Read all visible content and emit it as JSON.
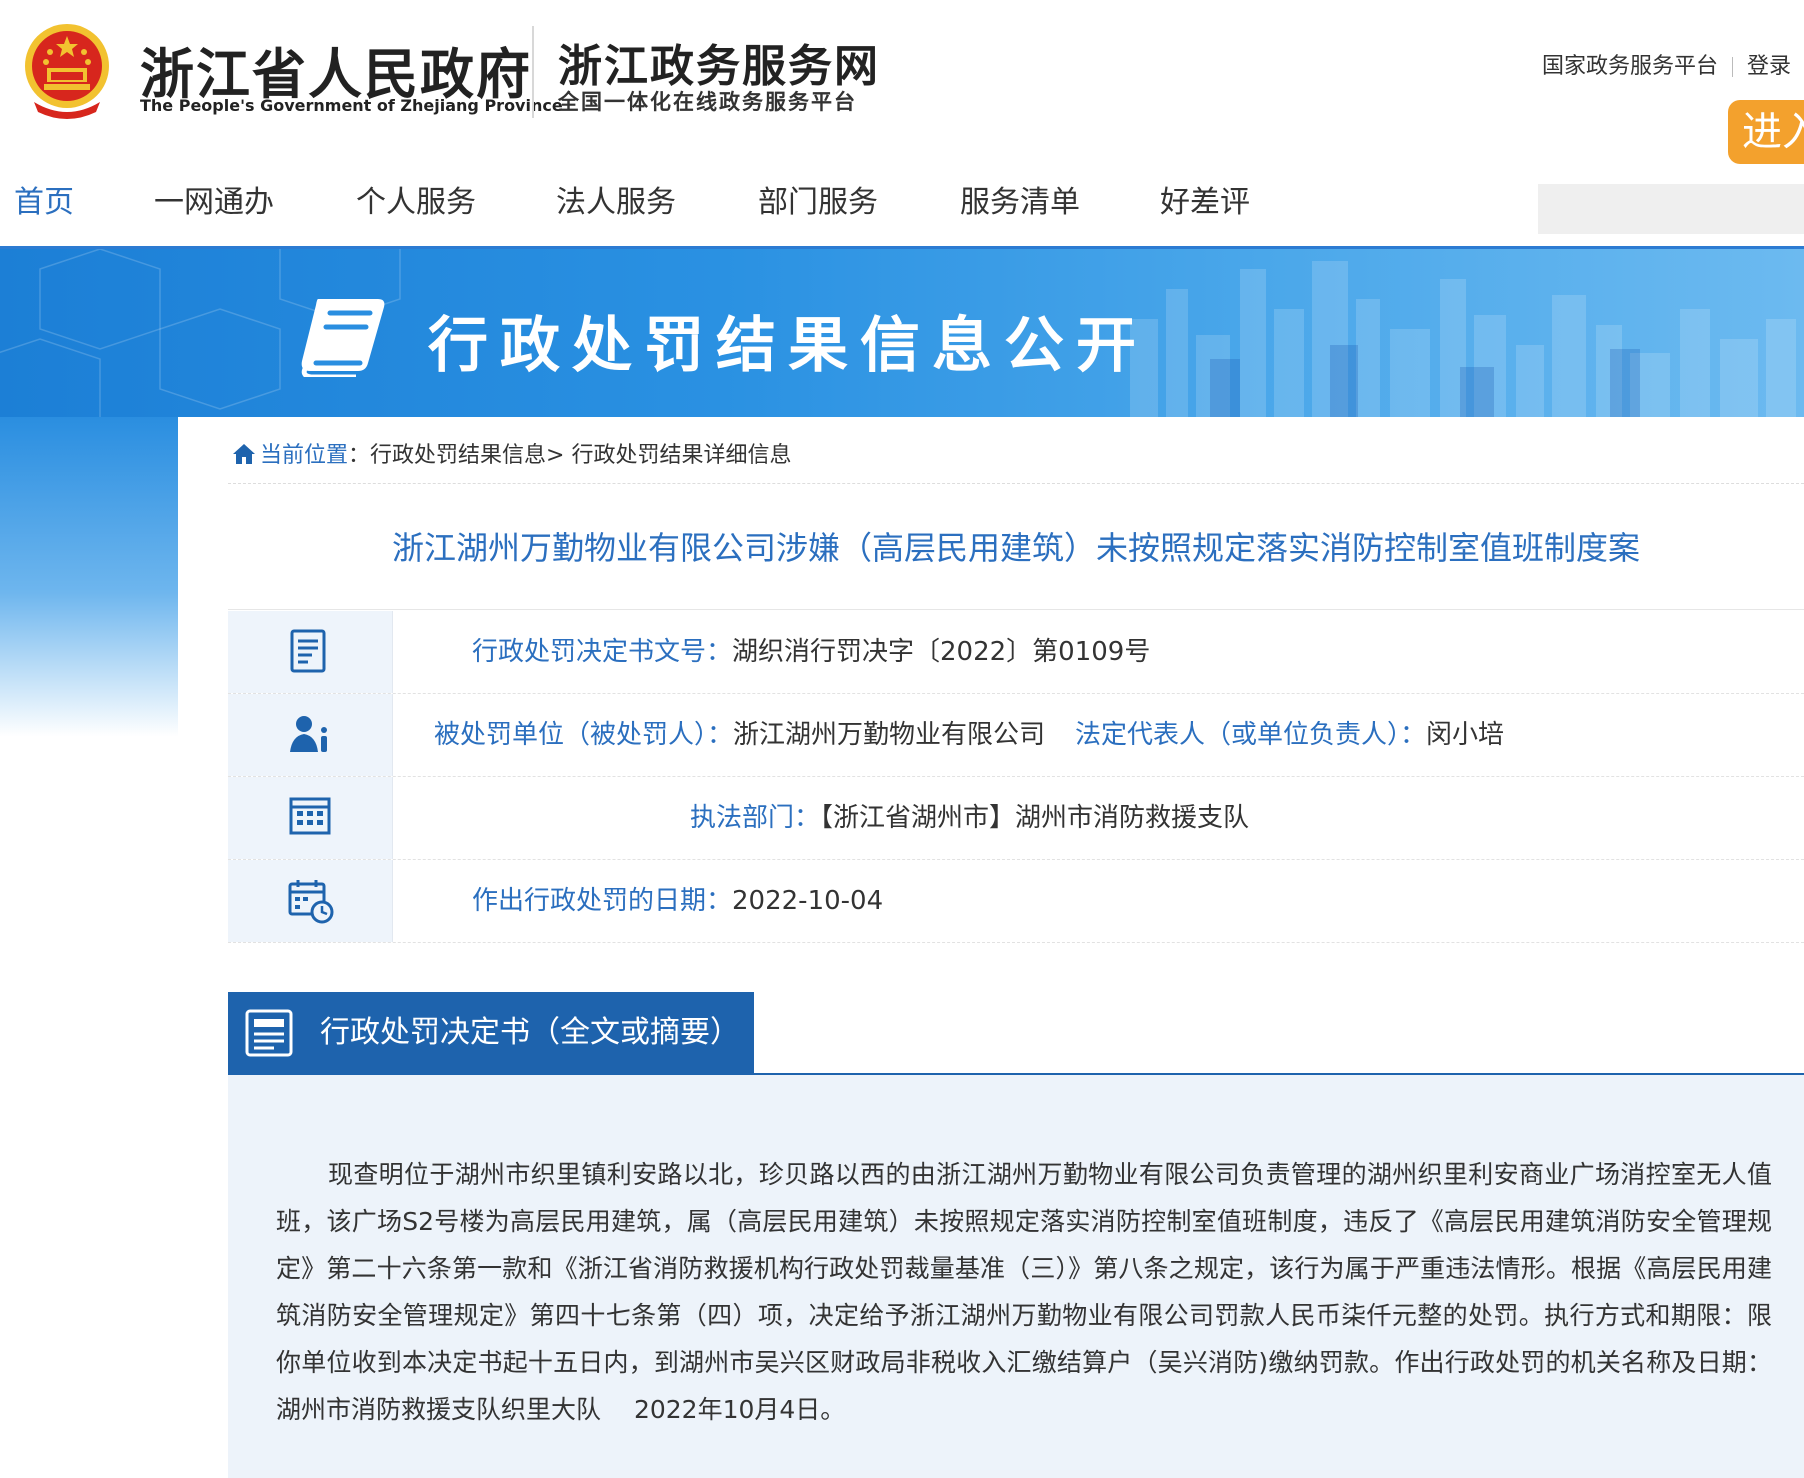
{
  "header": {
    "gov_cn": "浙江省人民政府",
    "gov_en": "The People's Government of Zhejiang Province",
    "site_title": "浙江政务服务网",
    "site_sub": "全国一体化在线政务服务平台",
    "link_national": "国家政务服务平台",
    "link_login": "登录",
    "enter_label": "进入"
  },
  "nav": {
    "items": [
      {
        "label": "首页"
      },
      {
        "label": "一网通办"
      },
      {
        "label": "个人服务"
      },
      {
        "label": "法人服务"
      },
      {
        "label": "部门服务"
      },
      {
        "label": "服务清单"
      },
      {
        "label": "好差评"
      }
    ]
  },
  "banner": {
    "title": "行政处罚结果信息公开"
  },
  "breadcrumb": {
    "current_label": "当前位置",
    "colon": "：",
    "level1": "行政处罚结果信息",
    "sep": ">",
    "level2": "行政处罚结果详细信息"
  },
  "case": {
    "title": "浙江湖州万勤物业有限公司涉嫌（高层民用建筑）未按照规定落实消防控制室值班制度案",
    "doc_no_label": "行政处罚决定书文号：",
    "doc_no": "湖织消行罚决字〔2022〕第0109号",
    "party_label": "被处罚单位（被处罚人）：",
    "party": "浙江湖州万勤物业有限公司",
    "rep_label": "法定代表人（或单位负责人）：",
    "rep": "闵小培",
    "dept_label": "执法部门：",
    "dept": "【浙江省湖州市】湖州市消防救援支队",
    "date_label": "作出行政处罚的日期：",
    "date": "2022-10-04"
  },
  "decision": {
    "heading": "行政处罚决定书（全文或摘要）",
    "body": "现查明位于湖州市织里镇利安路以北，珍贝路以西的由浙江湖州万勤物业有限公司负责管理的湖州织里利安商业广场消控室无人值班，该广场S2号楼为高层民用建筑，属（高层民用建筑）未按照规定落实消防控制室值班制度，违反了《高层民用建筑消防安全管理规定》第二十六条第一款和《浙江省消防救援机构行政处罚裁量基准（三）》第八条之规定，该行为属于严重违法情形。根据《高层民用建筑消防安全管理规定》第四十七条第（四）项，决定给予浙江湖州万勤物业有限公司罚款人民币柒仟元整的处罚。执行方式和期限：限你单位收到本决定书起十五日内，到湖州市吴兴区财政局非税收入汇缴结算户（吴兴消防)缴纳罚款。作出行政处罚的机关名称及日期：湖州市消防救援支队织里大队　 2022年10月4日。"
  },
  "colors": {
    "primary": "#2b6fbf",
    "section": "#1e63ad",
    "accent": "#f3a12d",
    "emblem_red": "#d7261d",
    "emblem_gold": "#f2c230"
  },
  "icons": [
    "national-emblem-icon",
    "book-icon",
    "home-icon",
    "document-icon",
    "person-info-icon",
    "building-icon",
    "calendar-clock-icon"
  ]
}
